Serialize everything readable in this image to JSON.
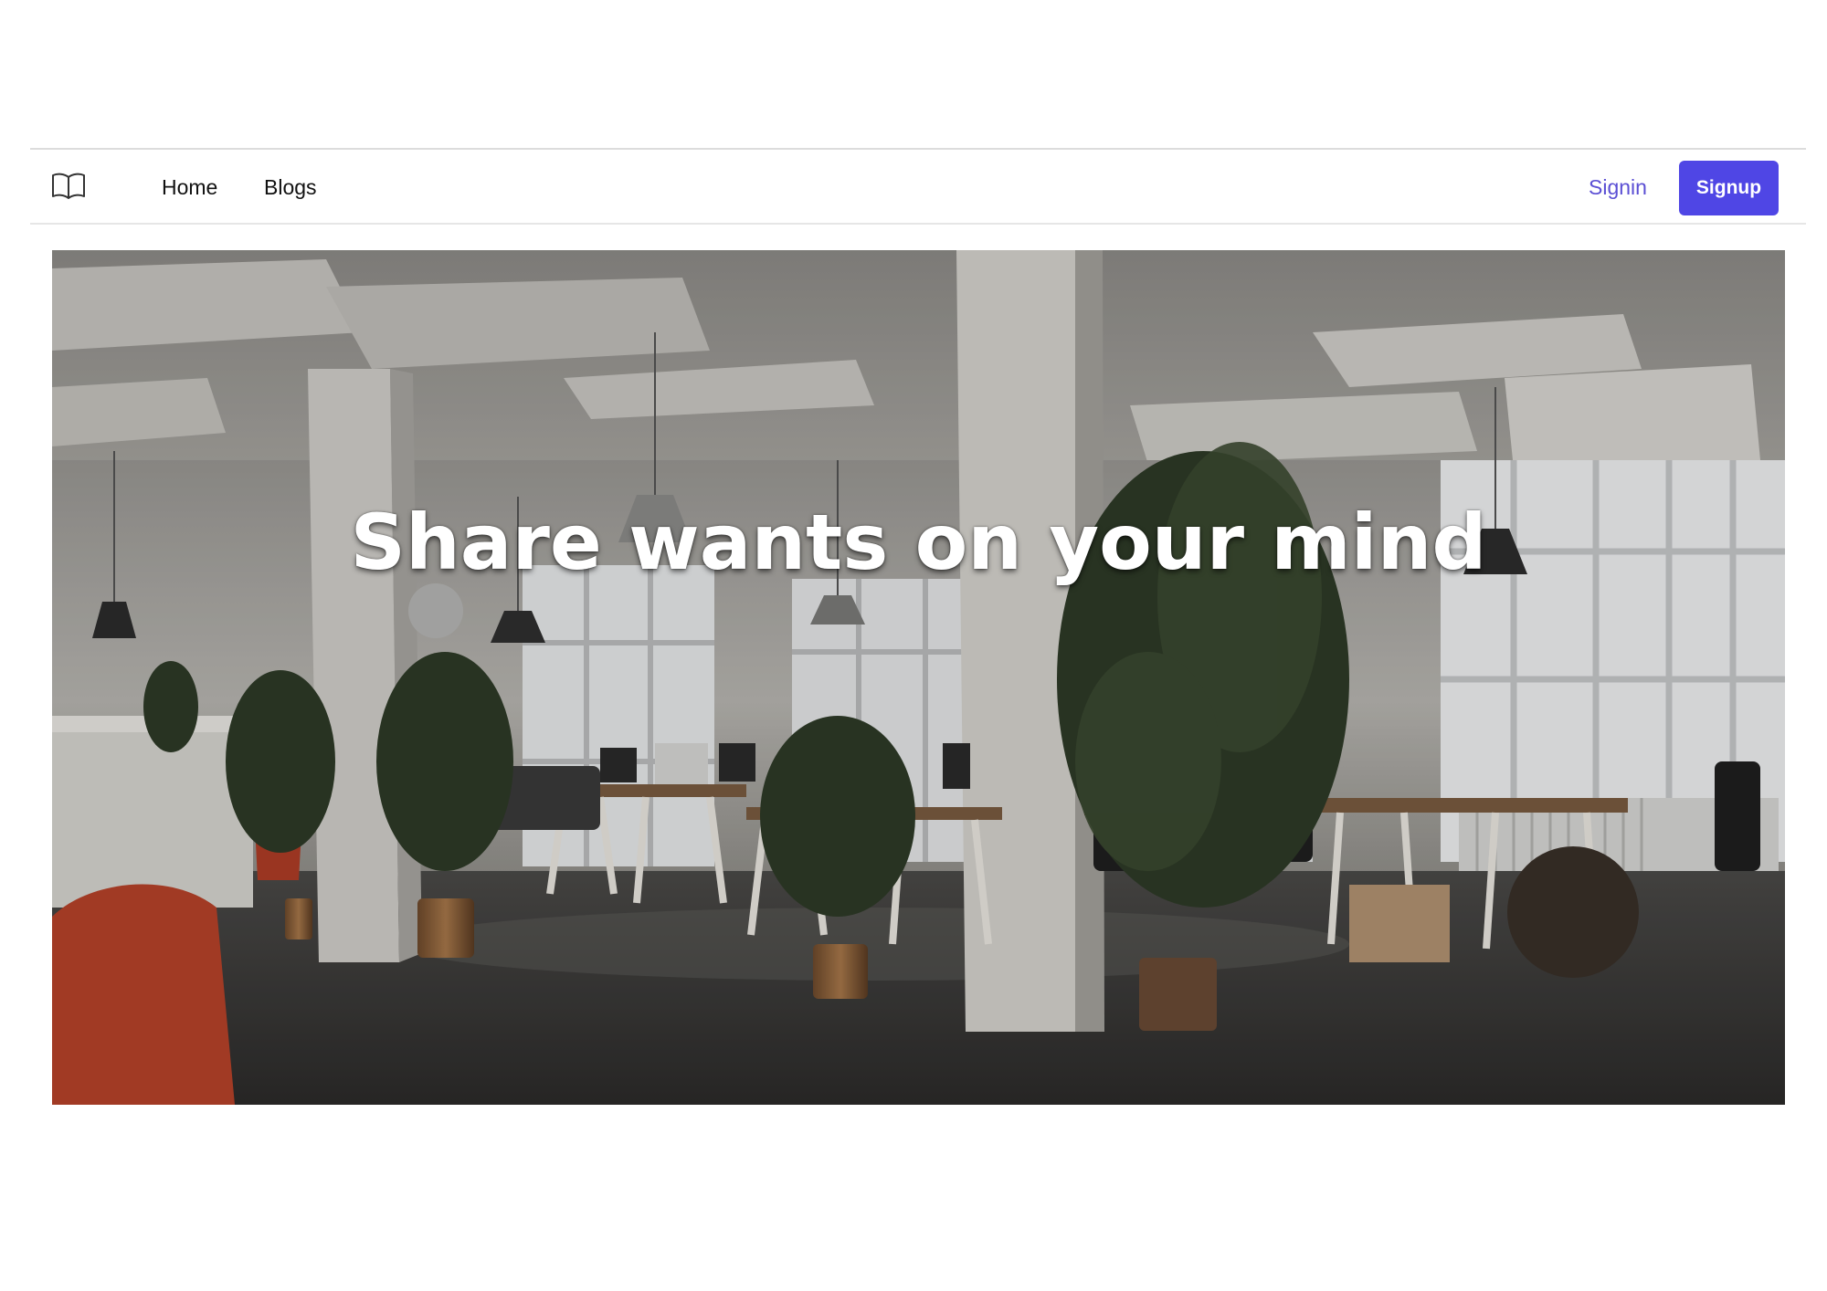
{
  "nav": {
    "logo_icon": "book-icon",
    "links": [
      {
        "label": "Home"
      },
      {
        "label": "Blogs"
      }
    ],
    "signin_label": "Signin",
    "signup_label": "Signup",
    "accent_color": "#4f46e5"
  },
  "hero": {
    "heading": "Share wants on your mind",
    "image_alt_subject": "open-plan office with plants, desks, pendant lamps and tall windows"
  }
}
